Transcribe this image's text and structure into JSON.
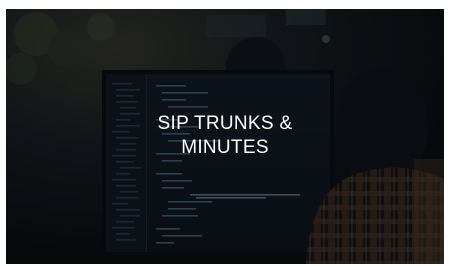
{
  "card": {
    "title_line1": "SIP TRUNKS &",
    "title_line2": "MINUTES"
  },
  "colors": {
    "overlay": "#0b1014",
    "text": "#ffffff",
    "code_highlight": "#8fb7c9",
    "shirt": "#6b4b3a"
  }
}
